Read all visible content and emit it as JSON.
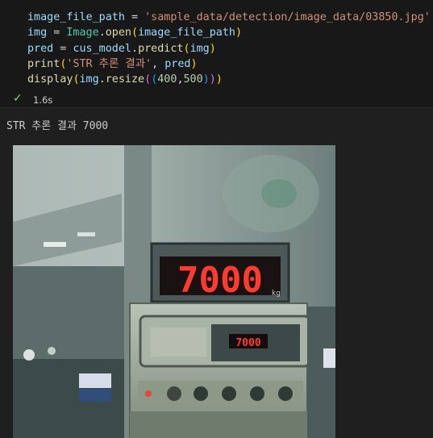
{
  "code": {
    "line1": {
      "var": "image_file_path",
      "op": " = ",
      "str": "'sample_data/detection/image_data/03850.jpg'"
    },
    "line2": {
      "var": "img",
      "op": " = ",
      "cls": "Image",
      "method": "open",
      "arg": "image_file_path"
    },
    "line3": {
      "var": "pred",
      "op": " = ",
      "obj": "cus_model",
      "method": "predict",
      "arg": "img"
    },
    "line4": {
      "fn": "print",
      "str": "'STR 추론 결과'",
      "arg": "pred"
    },
    "line5": {
      "fn": "display",
      "obj": "img",
      "method": "resize",
      "n1": "400",
      "n2": "500"
    }
  },
  "execution": {
    "status_icon": "check-icon",
    "time": "1.6s"
  },
  "output": {
    "text": "STR 추론 결과 7000",
    "image": {
      "big_display": "7000",
      "small_display": "7000",
      "unit": "kg"
    }
  },
  "colors": {
    "background": "#1f1f1f",
    "check": "#89d185",
    "led": "#ff3b2f"
  }
}
